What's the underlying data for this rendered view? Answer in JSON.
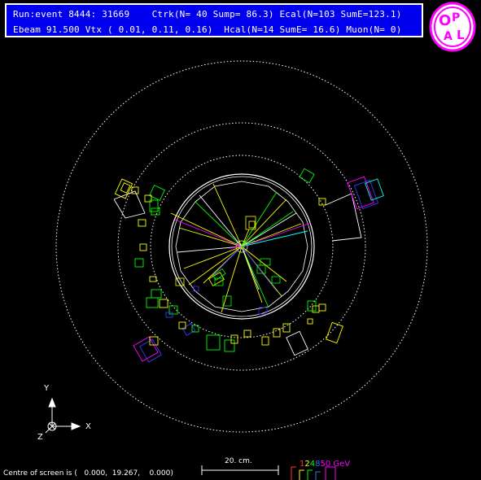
{
  "header": {
    "line1": "Run:event 8444: 31669    Ctrk(N= 40 Sump= 86.3) Ecal(N=103 SumE=123.1)",
    "line2": "Ebeam 91.500 Vtx ( 0.01, 0.11, 0.16)  Hcal(N=14 SumE= 16.6) Muon(N= 0)"
  },
  "logo": {
    "text": "OPAL",
    "colors": {
      "bg": "#ffffff",
      "ring": "#ff00ff"
    }
  },
  "axes": {
    "y_label": "Y",
    "x_label": "X",
    "z_label": "Z"
  },
  "scale": {
    "label": "20. cm."
  },
  "energy_scale": {
    "values": [
      {
        "text": "1",
        "color": "#ff3030"
      },
      {
        "text": "2",
        "color": "#ffff00"
      },
      {
        "text": "4",
        "color": "#00ff00"
      },
      {
        "text": "8",
        "color": "#3a6bff"
      },
      {
        "text": "50 GeV",
        "color": "#ff00ff"
      }
    ]
  },
  "footer": {
    "centre_text": "Centre of screen is (   0.000,  19.267,    0.000)"
  },
  "colors": {
    "background": "#000000",
    "header_bg": "#0000ee",
    "detector": "#ffffff",
    "track_yellow": "#ffff00",
    "track_green": "#00ff00",
    "track_cyan": "#00ffff",
    "track_magenta": "#ff00ff",
    "track_blue": "#3a3aff"
  }
}
